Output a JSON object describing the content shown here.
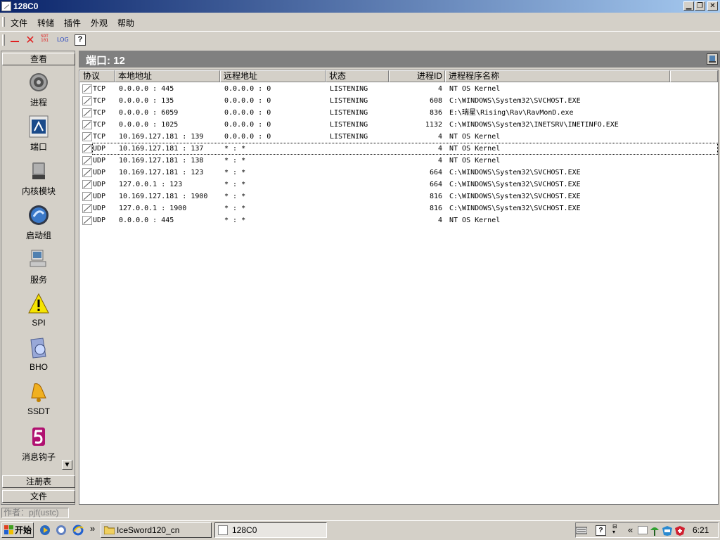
{
  "window": {
    "title": "128C0"
  },
  "menu": [
    "文件",
    "转储",
    "插件",
    "外观",
    "帮助"
  ],
  "toolbar": {
    "sdt_label": "SDT",
    "log_label": "LOG",
    "help_label": "?"
  },
  "left_panel": {
    "header": "查看",
    "items": [
      "进程",
      "端口",
      "内核模块",
      "启动组",
      "服务",
      "SPI",
      "BHO",
      "SSDT",
      "消息钩子"
    ],
    "footer_items": [
      "注册表",
      "文件"
    ]
  },
  "main": {
    "header": "端口: 12",
    "columns": [
      "协议",
      "本地地址",
      "远程地址",
      "状态",
      "进程ID",
      "进程程序名称"
    ],
    "rows": [
      [
        "TCP",
        "0.0.0.0 : 445",
        "0.0.0.0 : 0",
        "LISTENING",
        "4",
        "NT OS Kernel"
      ],
      [
        "TCP",
        "0.0.0.0 : 135",
        "0.0.0.0 : 0",
        "LISTENING",
        "608",
        "C:\\WINDOWS\\System32\\SVCHOST.EXE"
      ],
      [
        "TCP",
        "0.0.0.0 : 6059",
        "0.0.0.0 : 0",
        "LISTENING",
        "836",
        "E:\\瑞星\\Rising\\Rav\\RavMonD.exe"
      ],
      [
        "TCP",
        "0.0.0.0 : 1025",
        "0.0.0.0 : 0",
        "LISTENING",
        "1132",
        "C:\\WINDOWS\\System32\\INETSRV\\INETINFO.EXE"
      ],
      [
        "TCP",
        "10.169.127.181 : 139",
        "0.0.0.0 : 0",
        "LISTENING",
        "4",
        "NT OS Kernel"
      ],
      [
        "UDP",
        "10.169.127.181 : 137",
        "* : *",
        "",
        "4",
        "NT OS Kernel"
      ],
      [
        "UDP",
        "10.169.127.181 : 138",
        "* : *",
        "",
        "4",
        "NT OS Kernel"
      ],
      [
        "UDP",
        "10.169.127.181 : 123",
        "* : *",
        "",
        "664",
        "C:\\WINDOWS\\System32\\SVCHOST.EXE"
      ],
      [
        "UDP",
        "127.0.0.1 : 123",
        "* : *",
        "",
        "664",
        "C:\\WINDOWS\\System32\\SVCHOST.EXE"
      ],
      [
        "UDP",
        "10.169.127.181 : 1900",
        "* : *",
        "",
        "816",
        "C:\\WINDOWS\\System32\\SVCHOST.EXE"
      ],
      [
        "UDP",
        "127.0.0.1 : 1900",
        "* : *",
        "",
        "816",
        "C:\\WINDOWS\\System32\\SVCHOST.EXE"
      ],
      [
        "UDP",
        "0.0.0.0 : 445",
        "* : *",
        "",
        "4",
        "NT OS Kernel"
      ]
    ],
    "selected_row": 5
  },
  "status": {
    "text": "作者：pjf(ustc)"
  },
  "taskbar": {
    "start_label": "开始",
    "quick_launch_more": "»",
    "tasks": [
      "IceSword120_cn",
      "128C0"
    ],
    "tray_more": "«",
    "clock": "6:21"
  },
  "colors": {
    "title_start": "#0a246a",
    "title_end": "#a6caf0",
    "face": "#d4d0c8",
    "header_bar": "#808080"
  },
  "icons": [
    "window-icon",
    "minimize-icon",
    "restore-icon",
    "close-icon",
    "process-gear-icon",
    "port-icon",
    "kernel-module-icon",
    "startup-icon",
    "service-icon",
    "spi-warning-icon",
    "bho-icon",
    "ssdt-bell-icon",
    "hook-icon",
    "scroll-down-icon",
    "start-flag-icon",
    "media-player-icon",
    "ie-icon",
    "folder-icon",
    "keyboard-icon",
    "help-icon",
    "shield-icon"
  ]
}
